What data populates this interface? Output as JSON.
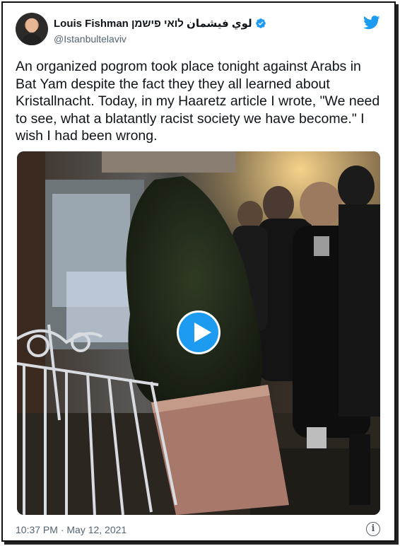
{
  "author": {
    "display_name": "Louis Fishman لوي فيشمان לואי פישמן",
    "handle": "@Istanbultelaviv",
    "verified": true,
    "avatar_icon": "profile-photo"
  },
  "tweet": {
    "text": "An organized pogrom took place tonight against Arabs in Bat Yam despite the fact they they all learned about Kristallnacht. Today, in my Haaretz article I wrote, \"We need to see, what a blatantly racist society we have become.\" I wish I had been wrong.",
    "timestamp": "10:37 PM · May 12, 2021"
  },
  "media": {
    "type": "video",
    "play_icon": "play-icon"
  },
  "icons": {
    "brand": "twitter-bird-icon",
    "info": "info-icon",
    "verified": "verified-badge-icon"
  },
  "colors": {
    "brand_blue": "#1d9bf0",
    "text_primary": "#0f1419",
    "text_secondary": "#536471"
  }
}
